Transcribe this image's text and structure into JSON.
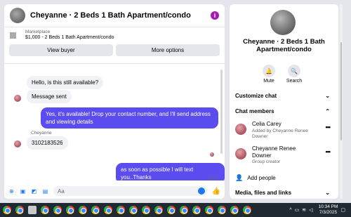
{
  "chat": {
    "title": "Cheyanne · 2 Beds 1 Bath Apartment/condo",
    "info_icon": "i",
    "marketplace_label": "Marketplace",
    "marketplace_desc": "$1,000 - 2 Beds 1 Bath Apartment/condo",
    "view_buyer": "View buyer",
    "more_options": "More options"
  },
  "messages": [
    {
      "text": "Hello, is this still available?"
    },
    {
      "text": "Message sent"
    },
    {
      "text": "Yes, it's available! Drop your contact number, and I'll send address and viewing details"
    },
    {
      "sender": "Cheyanne",
      "text": "3102183526"
    },
    {
      "text": "as soon as possible I will text you..Thanks"
    },
    {
      "status": "Sent"
    }
  ],
  "composer": {
    "placeholder": "Aa"
  },
  "side": {
    "title": "Cheyanne · 2 Beds 1 Bath Apartment/condo",
    "mute": "Mute",
    "search": "Search",
    "customize": "Customize chat",
    "members_header": "Chat members",
    "members": [
      {
        "name": "Celia Carey",
        "sub": "Added by Cheyanne Renee Downer"
      },
      {
        "name": "Cheyanne Renee Downer",
        "sub": "Group creator"
      }
    ],
    "add_people": "Add people",
    "media": "Media, files and links"
  },
  "taskbar": {
    "time": "10:34 PM",
    "date": "7/3/2025"
  },
  "colors": {
    "accent": "#5b4cf0",
    "brand": "#1877f2",
    "info": "#a21caf"
  }
}
